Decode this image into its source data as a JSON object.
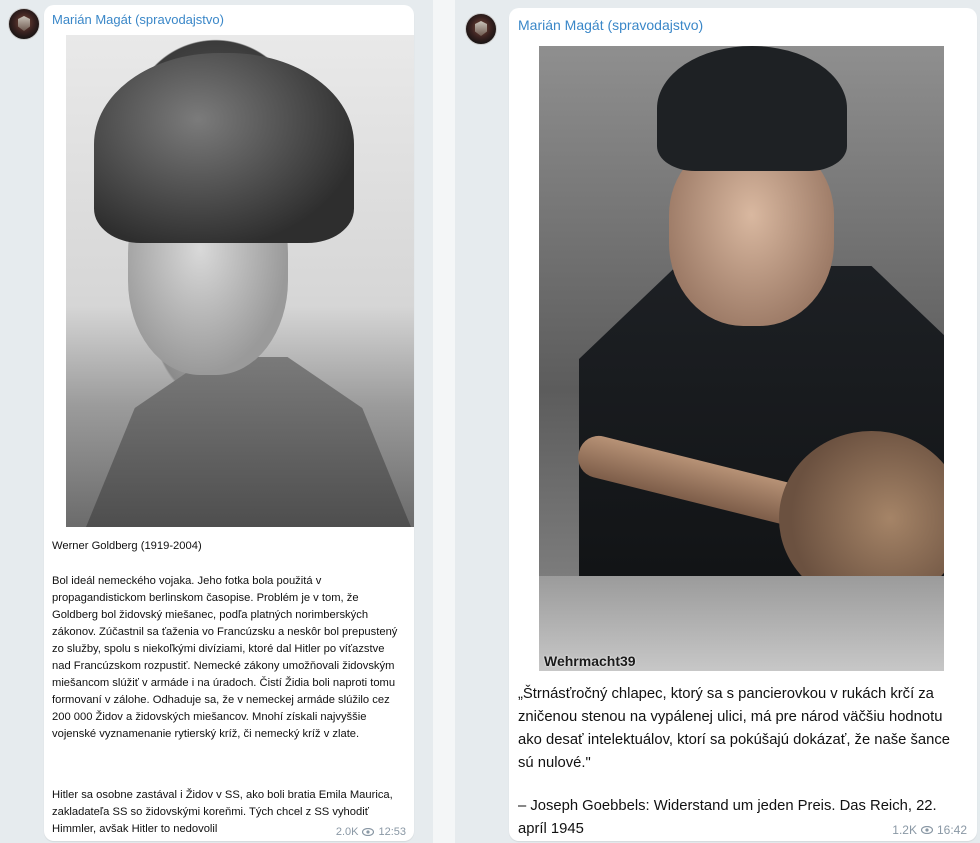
{
  "posts": [
    {
      "channel": "Marián Magát (spravodajstvo)",
      "caption_title": "Werner Goldberg (1919-2004)",
      "paragraphs": [
        "Bol ideál nemeckého vojaka. Jeho fotka bola použitá v propagandistickom berlinskom časopise. Problém je v tom, že Goldberg bol židovský miešanec, podľa platných norimberských zákonov. Zúčastnil sa ťaženia vo Francúzsku a neskôr bol prepustený zo služby, spolu s niekoľkými divíziami, ktoré dal Hitler po víťazstve nad Francúzskom rozpustiť. Nemecké zákony umožňovali židovským miešancom slúžiť v armáde i na úradoch. Čistí Židia boli naproti tomu formovaní v zálohe. Odhaduje sa, že v nemeckej armáde slúžilo cez 200 000 Židov a židovských miešancov. Mnohí získali najvyššie vojenské vyznamenanie rytierský kríž, či nemecký kríž v zlate.",
        "Hitler sa osobne zastával i Židov v SS, ako boli bratia Emila Maurica, zakladateľa SS so židovskými koreňmi. Tých chcel z SS vyhodiť Himmler, avšak Hitler to nedovolil"
      ],
      "views": "2.0K",
      "time": "12:53"
    },
    {
      "channel": "Marián Magát (spravodajstvo)",
      "watermark": "Wehrmacht39",
      "quote": "„Štrnásťročný chlapec, ktorý sa s pancierovkou v rukách krčí za zničenou stenou na vypálenej ulici, má pre národ väčšiu hodnotu ako desať intelektuálov, ktorí sa pokúšajú dokázať, že naše šance sú nulové.\"",
      "attribution": "– Joseph Goebbels: Widerstand um jeden Preis. Das Reich, 22. apríl 1945",
      "views": "1.2K",
      "time": "16:42"
    }
  ],
  "colors": {
    "channel_name": "#3a87c8",
    "meta": "#8a98a5",
    "card": "#ffffff",
    "background": "#e6ebee"
  },
  "icons": [
    "channel-avatar-icon",
    "eye-icon"
  ]
}
